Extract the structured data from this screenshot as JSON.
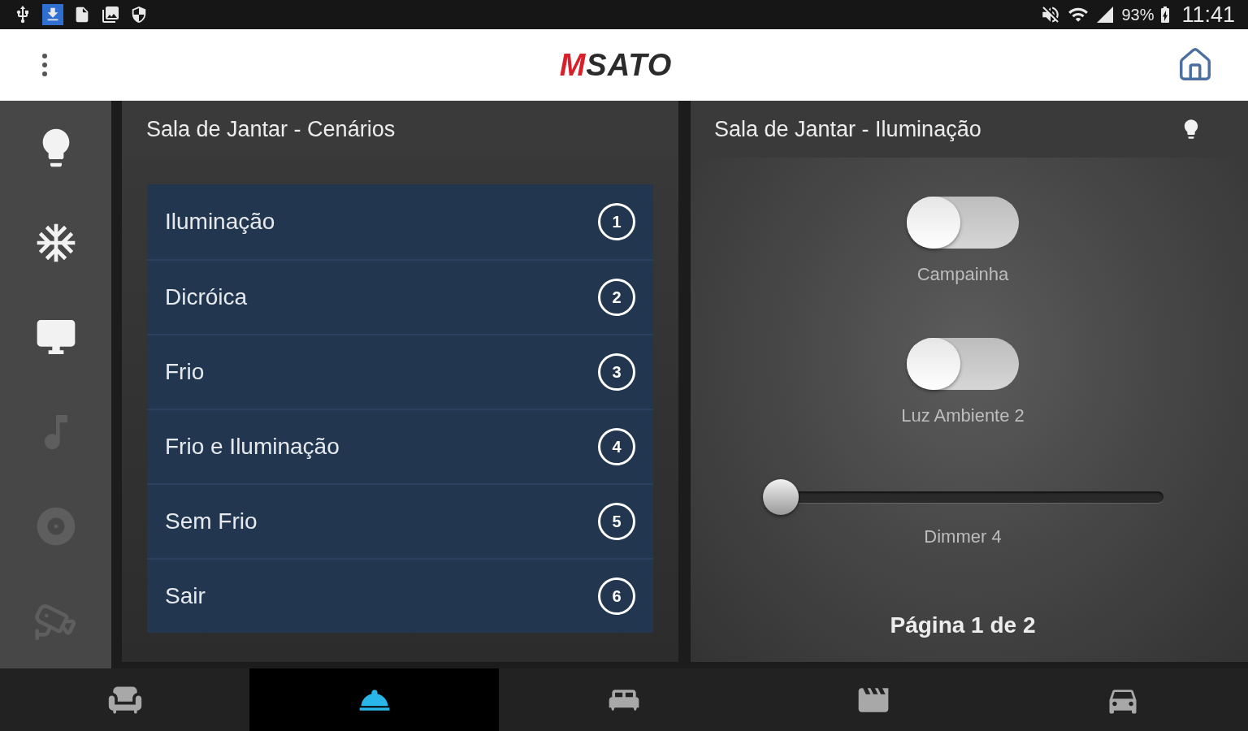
{
  "status_bar": {
    "battery_percent": "93%",
    "time": "11:41"
  },
  "app_bar": {
    "logo": {
      "accent": "M",
      "name": "SATO"
    }
  },
  "sidebar": {
    "items": [
      {
        "disabled": false
      },
      {
        "disabled": false
      },
      {
        "disabled": false
      },
      {
        "disabled": true
      },
      {
        "disabled": true
      },
      {
        "disabled": true
      }
    ]
  },
  "scenes_panel": {
    "title": "Sala de Jantar - Cenários",
    "scenes": [
      {
        "label": "Iluminação",
        "number": "1"
      },
      {
        "label": "Dicróica",
        "number": "2"
      },
      {
        "label": "Frio",
        "number": "3"
      },
      {
        "label": "Frio e Iluminação",
        "number": "4"
      },
      {
        "label": "Sem Frio",
        "number": "5"
      },
      {
        "label": "Sair",
        "number": "6"
      }
    ]
  },
  "lighting_panel": {
    "title": "Sala de Jantar - Iluminação",
    "controls": [
      {
        "kind": "toggle",
        "label": "Campainha",
        "on": false
      },
      {
        "kind": "toggle",
        "label": "Luz Ambiente 2",
        "on": false
      },
      {
        "kind": "slider",
        "label": "Dimmer 4",
        "level": 0
      }
    ],
    "pagination": "Página 1 de 2"
  },
  "bottom_nav": {
    "tabs": [
      {
        "selected": false
      },
      {
        "selected": true
      },
      {
        "selected": false
      },
      {
        "selected": false
      },
      {
        "selected": false
      }
    ]
  }
}
